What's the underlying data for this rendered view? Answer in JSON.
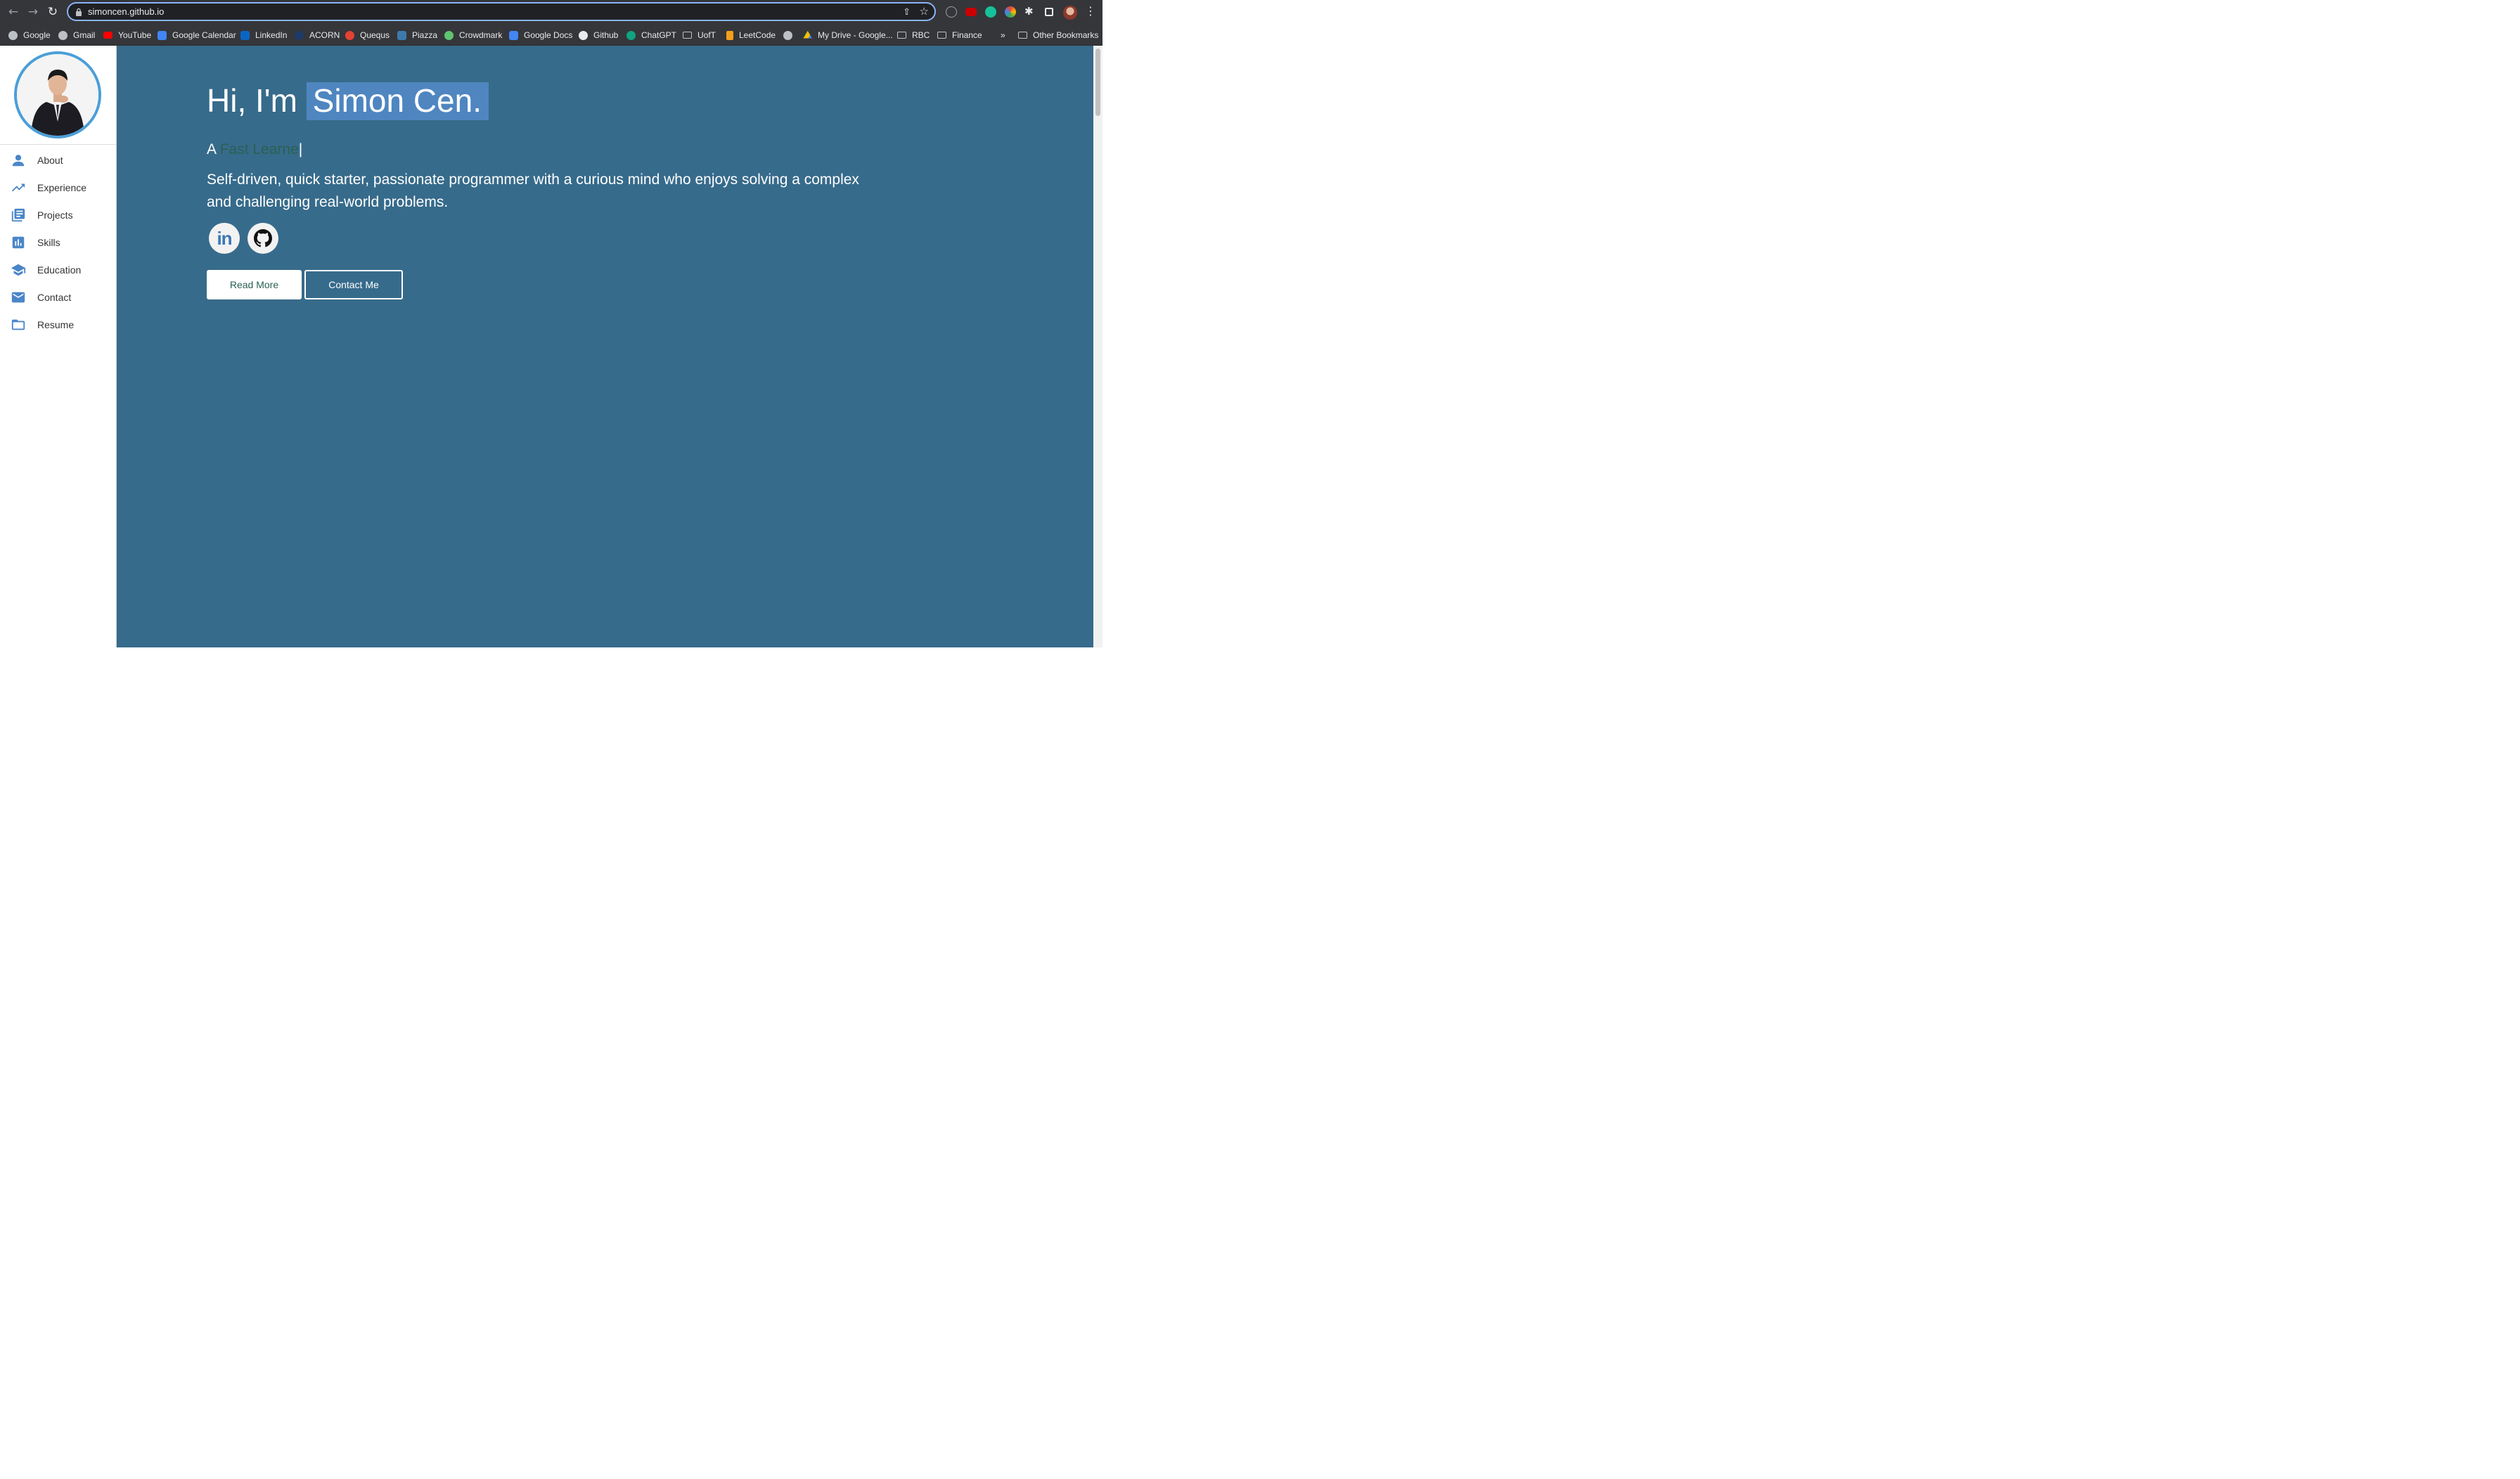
{
  "browser": {
    "url": "simoncen.github.io",
    "bookmarks": [
      {
        "label": "Google",
        "icon": "globe"
      },
      {
        "label": "Gmail",
        "icon": "globe"
      },
      {
        "label": "YouTube",
        "icon": "yt"
      },
      {
        "label": "Google Calendar",
        "icon": "cal"
      },
      {
        "label": "LinkedIn",
        "icon": "li"
      },
      {
        "label": "ACORN",
        "icon": "acorn"
      },
      {
        "label": "Quequs",
        "icon": "quercus"
      },
      {
        "label": "Piazza",
        "icon": "piazza"
      },
      {
        "label": "Crowdmark",
        "icon": "crowd"
      },
      {
        "label": "Google Docs",
        "icon": "docs"
      },
      {
        "label": "Github",
        "icon": "gh"
      },
      {
        "label": "ChatGPT",
        "icon": "gpt"
      },
      {
        "label": "UofT",
        "icon": "folder"
      },
      {
        "label": "LeetCode",
        "icon": "leet"
      },
      {
        "label": "",
        "icon": "globe"
      },
      {
        "label": "My Drive - Google...",
        "icon": "drive"
      },
      {
        "label": "RBC",
        "icon": "folder"
      },
      {
        "label": "Finance",
        "icon": "folder"
      }
    ],
    "overflow_label": "»",
    "other_bookmarks_label": "Other Bookmarks"
  },
  "sidebar": {
    "items": [
      {
        "label": "About",
        "icon": "person-icon"
      },
      {
        "label": "Experience",
        "icon": "trending-up-icon"
      },
      {
        "label": "Projects",
        "icon": "library-books-icon"
      },
      {
        "label": "Skills",
        "icon": "bar-chart-icon"
      },
      {
        "label": "Education",
        "icon": "graduation-cap-icon"
      },
      {
        "label": "Contact",
        "icon": "mail-icon"
      },
      {
        "label": "Resume",
        "icon": "folder-icon"
      }
    ]
  },
  "hero": {
    "greeting": "Hi, I'm",
    "name": "Simon Cen.",
    "role_prefix": "A",
    "role_typed": "Fast Learne",
    "role_cursor": "|",
    "description": "Self-driven, quick starter, passionate programmer with a curious mind who enjoys solving a complex and challenging real-world problems.",
    "linkedin_label": "in",
    "read_more_label": "Read More",
    "contact_me_label": "Contact Me"
  },
  "colors": {
    "hero_bg": "#376b8b",
    "name_highlight": "#4f86c0",
    "accent": "#4a86c8",
    "avatar_ring": "#4a9fd8",
    "role_text": "#2a6052"
  }
}
